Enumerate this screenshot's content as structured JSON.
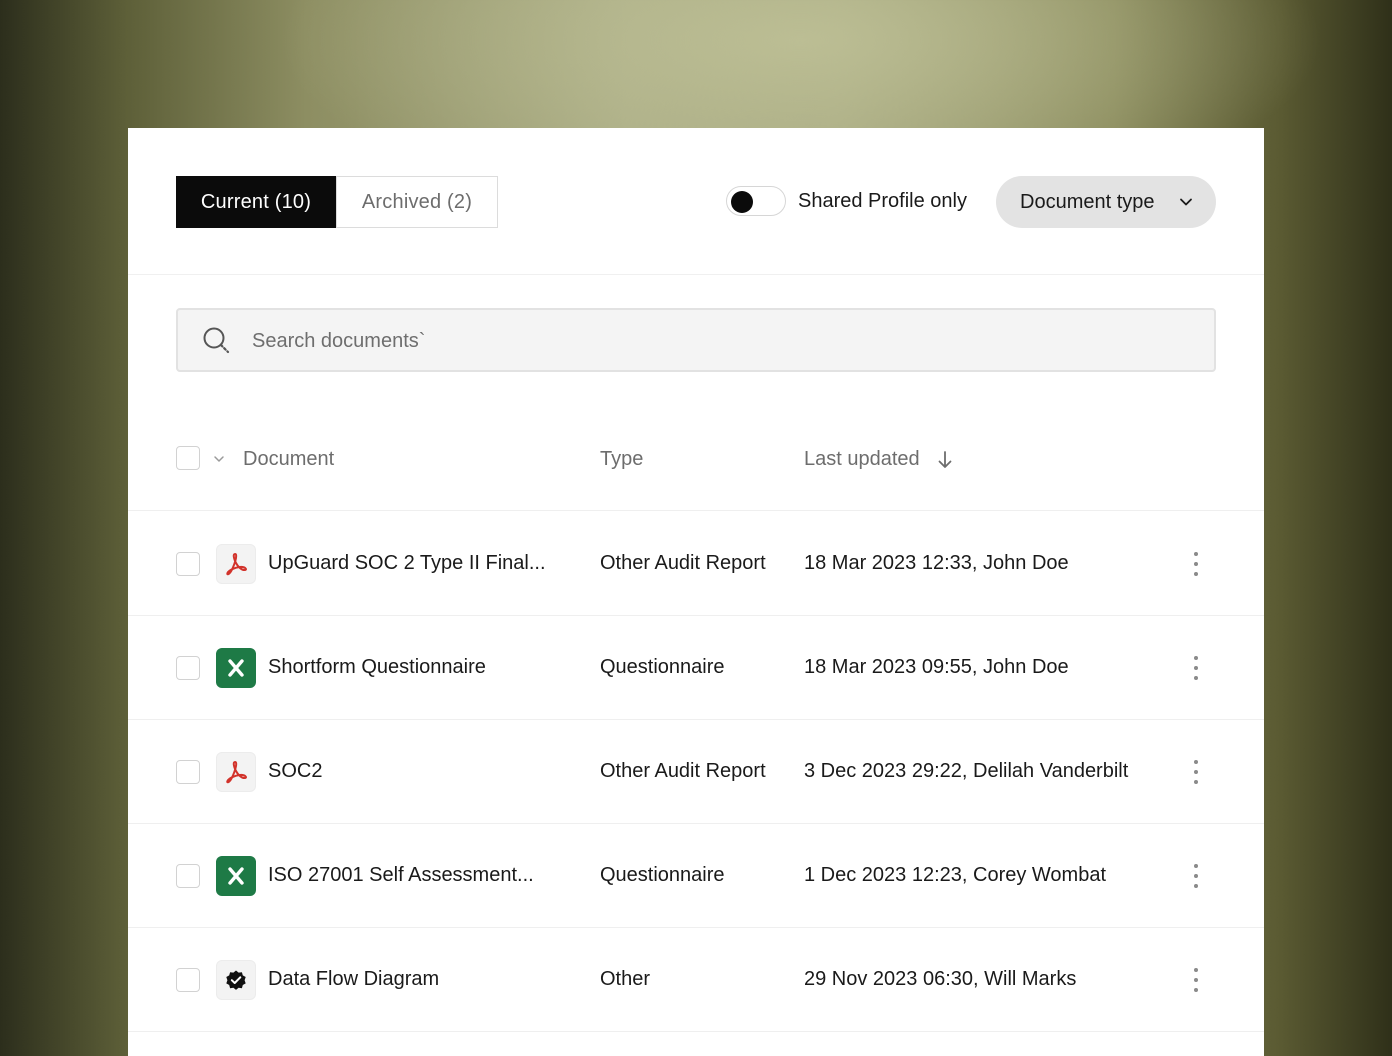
{
  "tabs": {
    "current": "Current (10)",
    "archived": "Archived (2)"
  },
  "toggle": {
    "label": "Shared Profile only",
    "on": false
  },
  "filter": {
    "label": "Document type"
  },
  "search": {
    "placeholder": "Search documents`"
  },
  "table": {
    "headers": {
      "document": "Document",
      "type": "Type",
      "last_updated": "Last updated"
    },
    "rows": [
      {
        "icon": "pdf-icon",
        "name": "UpGuard SOC 2 Type II Final...",
        "type": "Other Audit Report",
        "updated": "18 Mar 2023 12:33, John Doe"
      },
      {
        "icon": "excel-icon",
        "name": "Shortform Questionnaire",
        "type": "Questionnaire",
        "updated": "18 Mar 2023 09:55, John Doe"
      },
      {
        "icon": "pdf-icon",
        "name": "SOC2",
        "type": "Other Audit Report",
        "updated": "3 Dec 2023 29:22, Delilah Vanderbilt"
      },
      {
        "icon": "excel-icon",
        "name": "ISO 27001 Self Assessment...",
        "type": "Questionnaire",
        "updated": "1 Dec 2023 12:23, Corey Wombat"
      },
      {
        "icon": "verified-badge-icon",
        "name": "Data Flow Diagram",
        "type": "Other",
        "updated": "29 Nov 2023 06:30, Will Marks"
      }
    ]
  },
  "colors": {
    "accent": "#0b0b0b",
    "excel_green": "#1e7a46",
    "pdf_red": "#d2332b"
  }
}
